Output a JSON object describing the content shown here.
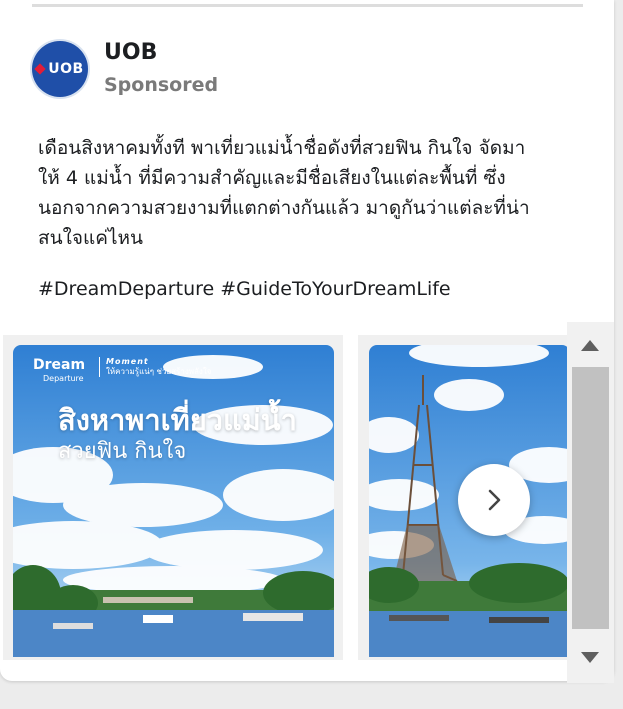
{
  "post": {
    "page_name": "UOB",
    "sponsored_label": "Sponsored",
    "avatar_text": "UOB",
    "text_line1": "เดือนสิงหาคมทั้งที พาเที่ยวแม่น้ำชื่อดังที่สวยฟิน กินใจ จัดมา",
    "text_line2": "ให้ 4 แม่น้ำ ที่มีความสำคัญและมีชื่อเสียงในแต่ละพื้นที่ ซึ่ง",
    "text_line3": "นอกจากความสวยงามที่แตกต่างกันแล้ว มาดูกันว่าแต่ละที่น่า",
    "text_line4": "สนใจแค่ไหน",
    "hashtags": "#DreamDeparture #GuideToYourDreamLife"
  },
  "carousel": {
    "slide1": {
      "logo_main": "Dream",
      "logo_sub": "Departure",
      "tagline_title": "Moment",
      "tagline_text": "ให้ความรู้แน่ๆ ช่วยสร้างพลังใจ",
      "headline": "สิงหาพาเที่ยวแม่น้ำ",
      "subheadline": "สวยฟิน กินใจ"
    }
  },
  "colors": {
    "brand_blue": "#1f4fa8",
    "brand_red": "#e21d38",
    "sky_top": "#2f7fd3",
    "river": "#4c86c7"
  },
  "icons": {
    "next": "chevron-right-icon",
    "scroll_up": "triangle-up-icon",
    "scroll_down": "triangle-down-icon"
  }
}
